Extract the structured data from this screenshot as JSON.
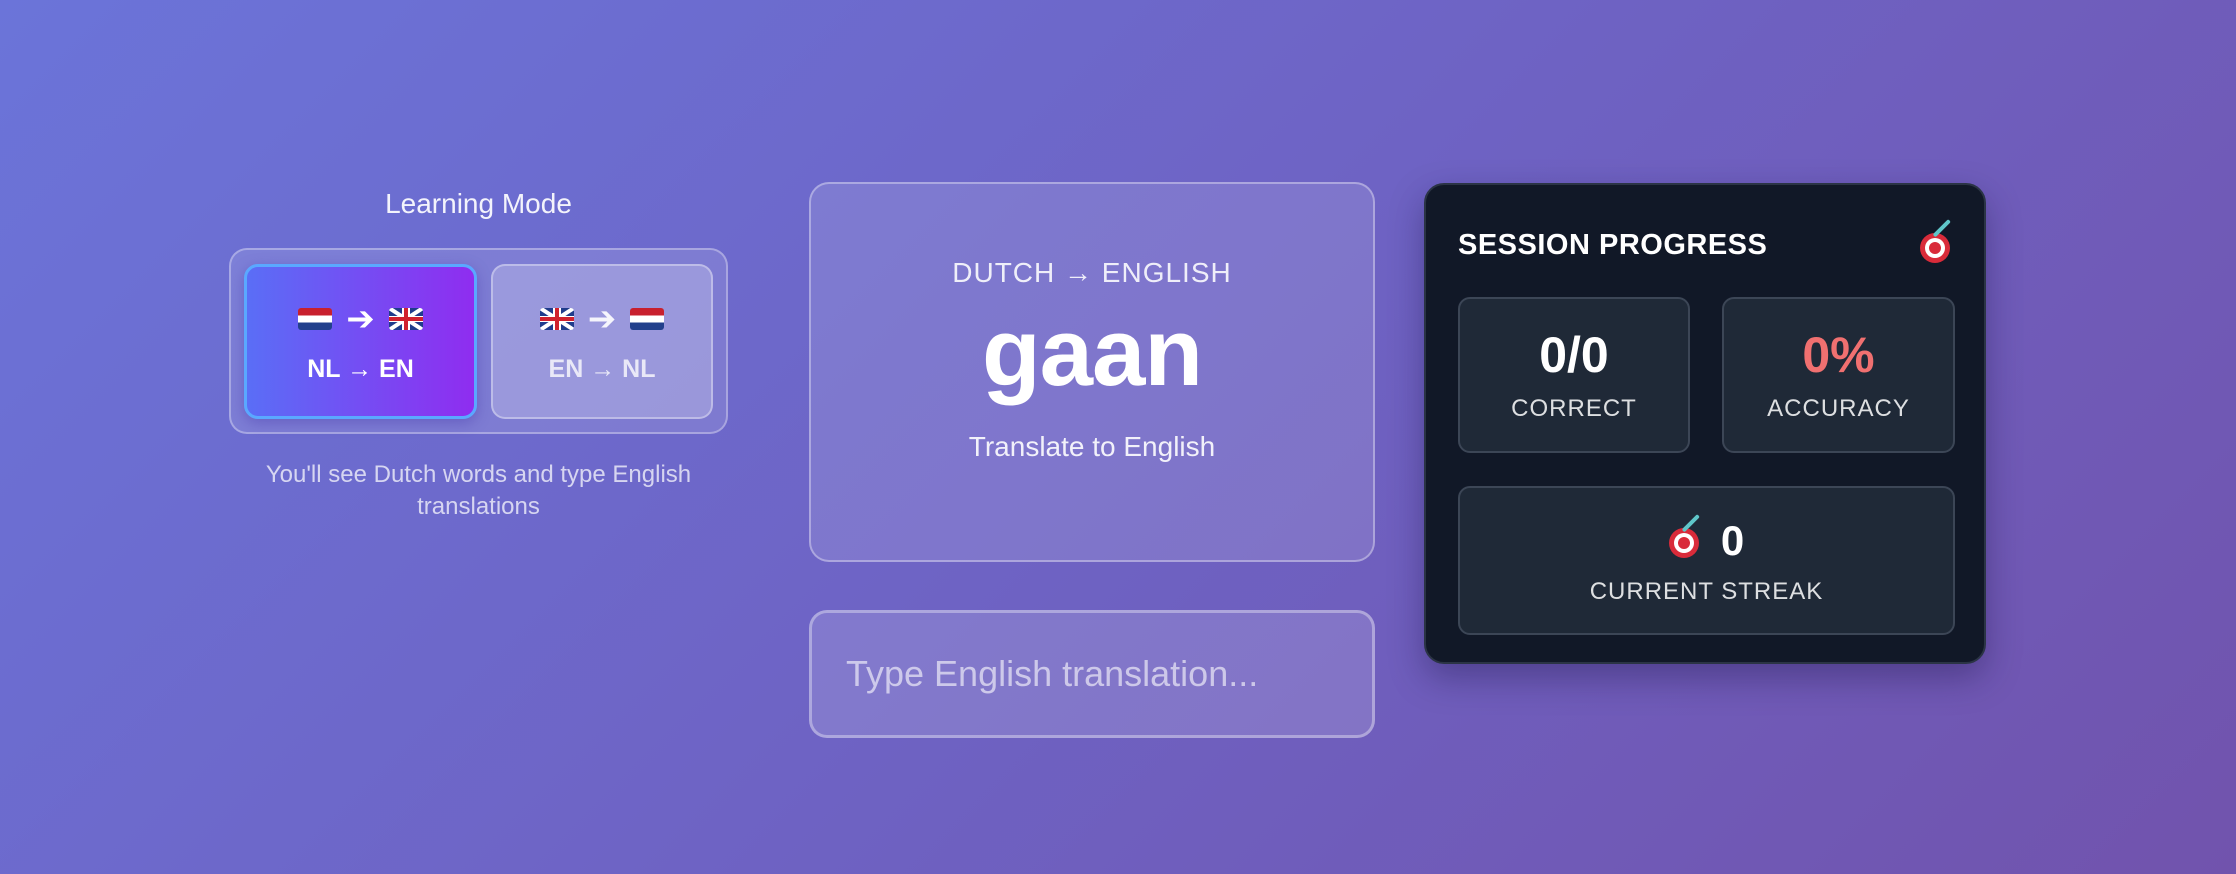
{
  "learning_mode": {
    "title": "Learning Mode",
    "options": [
      {
        "label": "NL → EN",
        "from_flag": "dutch-flag-icon",
        "to_flag": "uk-flag-icon",
        "selected": true
      },
      {
        "label": "EN → NL",
        "from_flag": "uk-flag-icon",
        "to_flag": "dutch-flag-icon",
        "selected": false
      }
    ],
    "arrow_glyph": "➔",
    "description": "You'll see Dutch words and type English translations"
  },
  "word_card": {
    "direction": "DUTCH → ENGLISH",
    "word": "gaan",
    "instruction": "Translate to English"
  },
  "answer": {
    "value": "",
    "placeholder": "Type English translation..."
  },
  "session_progress": {
    "title": "SESSION PROGRESS",
    "icon": "target-icon",
    "correct": {
      "value": "0/0",
      "label": "CORRECT"
    },
    "accuracy": {
      "value": "0%",
      "label": "ACCURACY",
      "color": "#f07070"
    },
    "streak": {
      "value": "0",
      "label": "CURRENT STREAK",
      "icon": "target-icon"
    }
  },
  "colors": {
    "background_start": "#6b74d9",
    "background_end": "#7153ad",
    "active_mode_start": "#5a6ef6",
    "active_mode_end": "#8f2df0",
    "panel_dark": "#111827",
    "stat_box": "#1f2937"
  }
}
